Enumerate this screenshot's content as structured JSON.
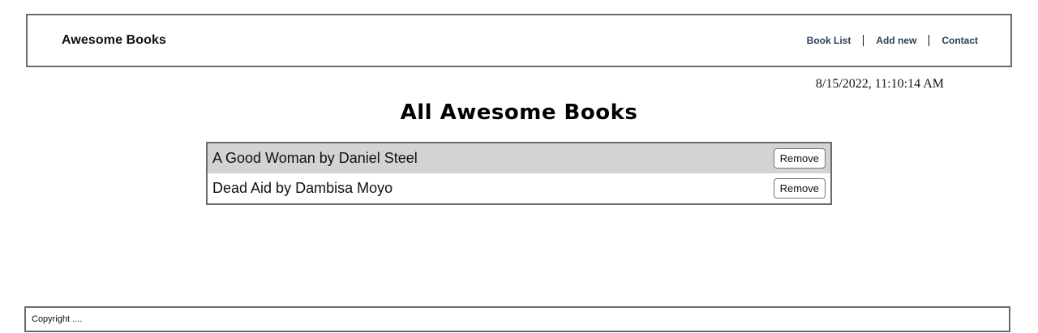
{
  "header": {
    "brand": "Awesome Books",
    "nav": [
      {
        "label": "Book List"
      },
      {
        "label": "Add new"
      },
      {
        "label": "Contact"
      }
    ]
  },
  "datetime": "8/15/2022, 11:10:14 AM",
  "main": {
    "title": "All Awesome Books",
    "books": [
      {
        "text": "A Good Woman by Daniel Steel",
        "remove_label": "Remove"
      },
      {
        "text": "Dead Aid by Dambisa Moyo",
        "remove_label": "Remove"
      }
    ]
  },
  "footer": {
    "text": "Copyright ...."
  },
  "colors": {
    "nav_link": "#2c3e5c",
    "border": "#6b6b6b",
    "shaded_row": "#d3d3d3"
  }
}
